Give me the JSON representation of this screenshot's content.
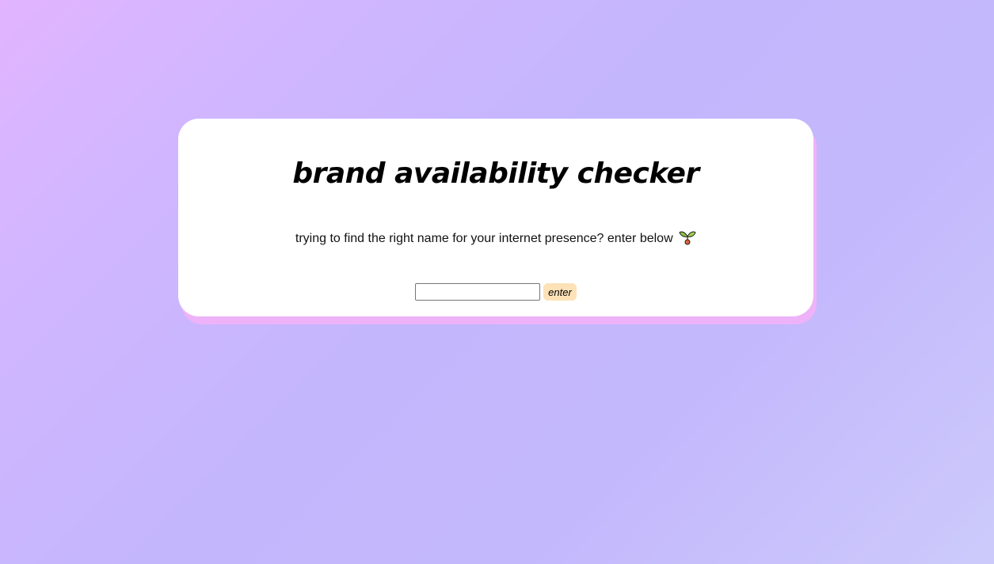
{
  "card": {
    "title": "brand availability checker",
    "subtitle": "trying to find the right name for your internet presence? enter below",
    "subtitle_icon": "sprout-icon"
  },
  "form": {
    "input_value": "",
    "input_placeholder": "",
    "submit_label": "enter"
  },
  "colors": {
    "background_start": "#e2b4ff",
    "background_end": "#cccafb",
    "card": "#ffffff",
    "card_shadow": "#eeb2f8",
    "button": "#fde2b8"
  }
}
